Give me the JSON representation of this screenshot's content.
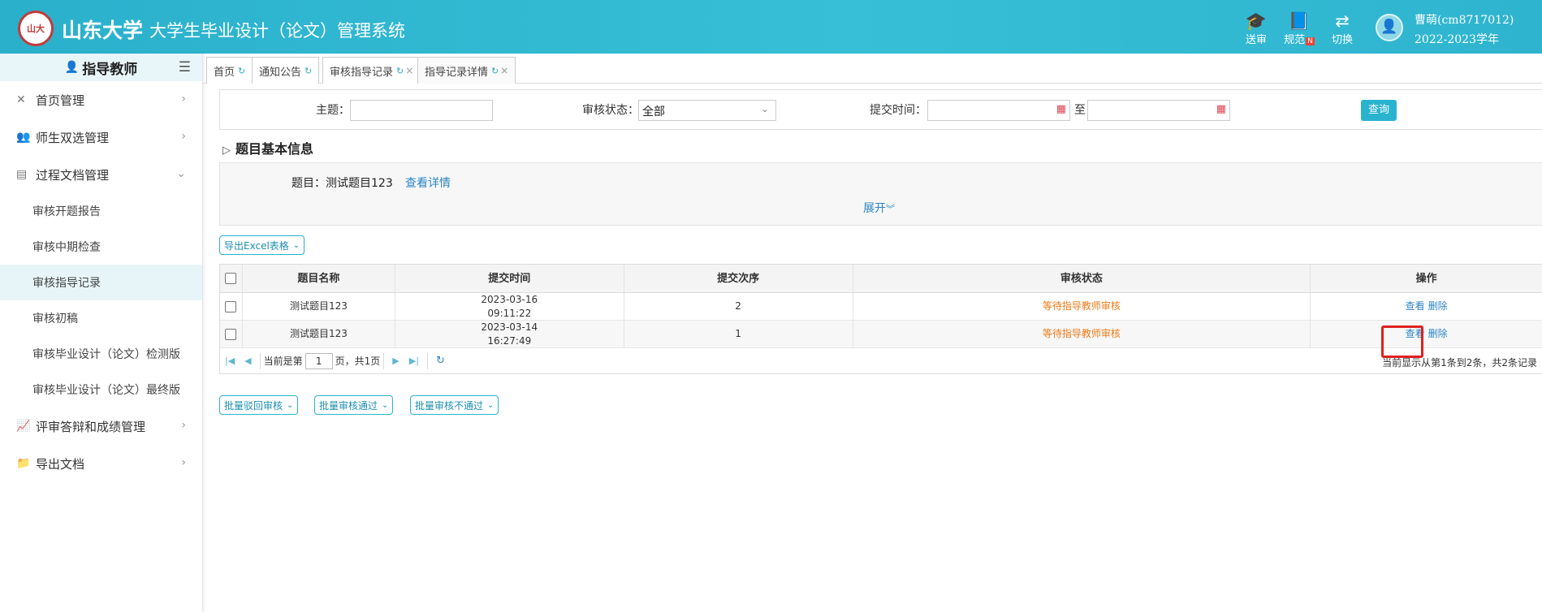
{
  "header": {
    "logo_text": "山大",
    "university": "山东大学",
    "system_title": "大学生毕业设计（论文）管理系统",
    "icons": [
      {
        "icon": "graduation-cap",
        "label": "送审"
      },
      {
        "icon": "book",
        "label": "规范",
        "badge": "N"
      },
      {
        "icon": "switch",
        "label": "切换"
      }
    ],
    "user": {
      "name": "曹萌(cm8717012)",
      "year": "2022-2023学年"
    }
  },
  "sidebar": {
    "role": "指导教师",
    "menu": [
      {
        "label": "首页管理",
        "icon": "tools-icon"
      },
      {
        "label": "师生双选管理",
        "icon": "users-icon"
      },
      {
        "label": "过程文档管理",
        "icon": "document-icon",
        "expanded": true
      }
    ],
    "sub_items": [
      {
        "label": "审核开题报告"
      },
      {
        "label": "审核中期检查"
      },
      {
        "label": "审核指导记录",
        "active": true
      },
      {
        "label": "审核初稿"
      },
      {
        "label": "审核毕业设计（论文）检测版"
      },
      {
        "label": "审核毕业设计（论文）最终版"
      }
    ],
    "menu_after": [
      {
        "label": "评审答辩和成绩管理",
        "icon": "chart-icon"
      },
      {
        "label": "导出文档",
        "icon": "folder-icon"
      }
    ]
  },
  "tabs": [
    {
      "label": "首页"
    },
    {
      "label": "通知公告"
    },
    {
      "label": "审核指导记录"
    },
    {
      "label": "指导记录详情",
      "active": true
    }
  ],
  "search": {
    "topic_label": "主题：",
    "topic_value": "",
    "status_label": "审核状态：",
    "status_value": "全部",
    "time_label": "提交时间：",
    "to_label": "至",
    "query_button": "查询"
  },
  "info": {
    "section_title": "题目基本信息",
    "topic_label": "题目：",
    "topic_value": "测试题目123",
    "detail_link": "查看详情",
    "expand_label": "展开"
  },
  "export_button": "导出Excel表格",
  "table": {
    "columns": [
      "题目名称",
      "提交时间",
      "提交次序",
      "审核状态",
      "操作"
    ],
    "rows": [
      {
        "name": "测试题目123",
        "date": "2023-03-16",
        "time": "09:11:22",
        "order": "2",
        "status": "等待指导教师审核"
      },
      {
        "name": "测试题目123",
        "date": "2023-03-14",
        "time": "16:27:49",
        "order": "1",
        "status": "等待指导教师审核"
      }
    ],
    "action_view": "查看",
    "action_delete": "删除",
    "status_color": "#f07a16"
  },
  "pager": {
    "current_prefix": "当前是第",
    "page": "1",
    "page_suffix": "页，共1页",
    "info": "当前显示从第1条到2条，共2条记录"
  },
  "batch": {
    "return": "批量驳回审核",
    "pass": "批量审核通过",
    "reject": "批量审核不通过"
  },
  "colors": {
    "header": "#36bfd6",
    "accent": "#2ab3cf",
    "link": "#2c86c5"
  }
}
